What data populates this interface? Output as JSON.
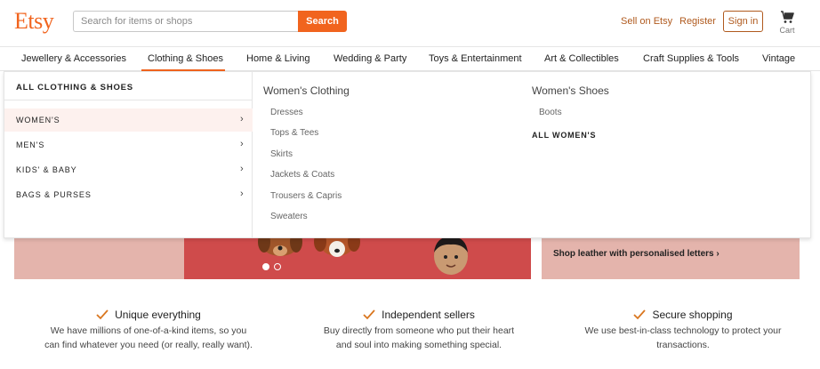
{
  "header": {
    "logo": "Etsy",
    "search_placeholder": "Search for items or shops",
    "search_button": "Search",
    "sell_link": "Sell on Etsy",
    "register_link": "Register",
    "signin_button": "Sign in",
    "cart_label": "Cart"
  },
  "nav": {
    "items": [
      "Jewellery & Accessories",
      "Clothing & Shoes",
      "Home & Living",
      "Wedding & Party",
      "Toys & Entertainment",
      "Art & Collectibles",
      "Craft Supplies & Tools",
      "Vintage"
    ],
    "active_index": 1
  },
  "dropdown": {
    "all_label": "ALL CLOTHING & SHOES",
    "categories": [
      "WOMEN'S",
      "MEN'S",
      "KIDS' & BABY",
      "BAGS & PURSES"
    ],
    "selected_index": 0,
    "womens_clothing": {
      "heading": "Women's Clothing",
      "links": [
        "Dresses",
        "Tops & Tees",
        "Skirts",
        "Jackets & Coats",
        "Trousers & Capris",
        "Sweaters"
      ]
    },
    "womens_shoes": {
      "heading": "Women's Shoes",
      "links": [
        "Boots"
      ],
      "all_link": "ALL WOMEN'S"
    }
  },
  "banner": {
    "cta": "Shop leather with personalised letters",
    "cta_arrow": "›",
    "carousel_dots": 2,
    "active_dot": 0
  },
  "value_props": [
    {
      "title": "Unique everything",
      "text_line1": "We have millions of one-of-a-kind items, so you",
      "text_line2": "can find whatever you need (or really, really want)."
    },
    {
      "title": "Independent sellers",
      "text_line1": "Buy directly from someone who put their heart",
      "text_line2": "and soul into making something special."
    },
    {
      "title": "Secure shopping",
      "text_line1": "We use best-in-class technology to protect your",
      "text_line2": "transactions."
    }
  ],
  "colors": {
    "brand": "#f1641e",
    "link": "#b05a1e",
    "banner_pink": "#e4b4ac",
    "banner_red": "#cf4b4b",
    "selected_bg": "#fdf1ee"
  }
}
